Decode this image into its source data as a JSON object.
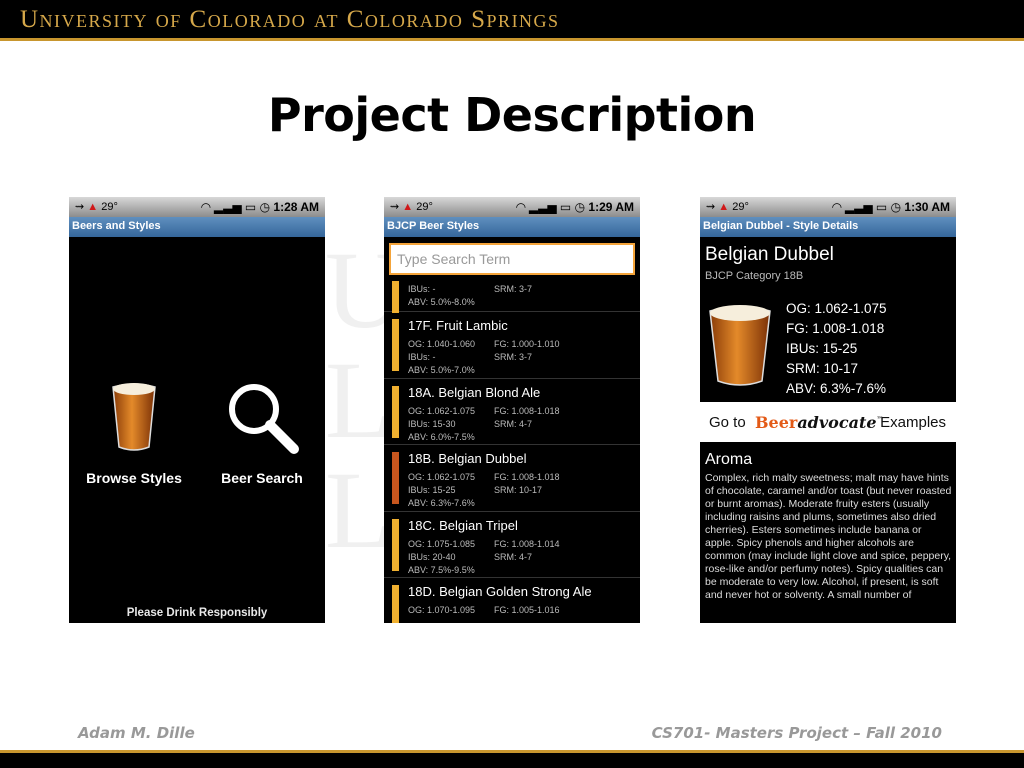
{
  "slide": {
    "banner_title": "University of Colorado at Colorado Springs",
    "title": "Project Description",
    "footer_left": "Adam M. Dille",
    "footer_right": "CS701- Masters Project – Fall 2010"
  },
  "colors": {
    "banner_gold": "#c8962e",
    "titlebar_blue": "#35669a",
    "search_border": "#f4a43a",
    "beeradvocate_orange": "#e35a17"
  },
  "phone1": {
    "status": {
      "temp": "29°",
      "time": "1:28 AM"
    },
    "titlebar": "Beers and Styles",
    "browse_label": "Browse Styles",
    "search_label": "Beer Search",
    "footer": "Please Drink Responsibly"
  },
  "phone2": {
    "status": {
      "temp": "29°",
      "time": "1:29 AM"
    },
    "titlebar": "BJCP Beer Styles",
    "search_placeholder": "Type Search Term",
    "partial": {
      "ibus": "IBUs: -",
      "srm": "SRM: 3-7",
      "abv": "ABV: 5.0%-8.0%",
      "color": "#f0b030"
    },
    "items": [
      {
        "name": "17F. Fruit Lambic",
        "og": "OG: 1.040-1.060",
        "fg": "FG: 1.000-1.010",
        "ibus": "IBUs: -",
        "srm": "SRM: 3-7",
        "abv": "ABV: 5.0%-7.0%",
        "color": "#f0b030"
      },
      {
        "name": "18A. Belgian Blond Ale",
        "og": "OG: 1.062-1.075",
        "fg": "FG: 1.008-1.018",
        "ibus": "IBUs: 15-30",
        "srm": "SRM: 4-7",
        "abv": "ABV: 6.0%-7.5%",
        "color": "#f0b030"
      },
      {
        "name": "18B. Belgian Dubbel",
        "og": "OG: 1.062-1.075",
        "fg": "FG: 1.008-1.018",
        "ibus": "IBUs: 15-25",
        "srm": "SRM: 10-17",
        "abv": "ABV: 6.3%-7.6%",
        "color": "#c8561e"
      },
      {
        "name": "18C. Belgian Tripel",
        "og": "OG: 1.075-1.085",
        "fg": "FG: 1.008-1.014",
        "ibus": "IBUs: 20-40",
        "srm": "SRM: 4-7",
        "abv": "ABV: 7.5%-9.5%",
        "color": "#f0b030"
      },
      {
        "name": "18D. Belgian Golden Strong Ale",
        "og": "OG: 1.070-1.095",
        "fg": "FG: 1.005-1.016",
        "ibus": "",
        "srm": "",
        "abv": "",
        "color": "#f0b030"
      }
    ]
  },
  "phone3": {
    "status": {
      "temp": "29°",
      "time": "1:30 AM"
    },
    "titlebar": "Belgian Dubbel - Style Details",
    "name": "Belgian Dubbel",
    "category": "BJCP Category 18B",
    "og": "OG: 1.062-1.075",
    "fg": "FG: 1.008-1.018",
    "ibus": "IBUs: 15-25",
    "srm": "SRM: 10-17",
    "abv": "ABV: 6.3%-7.6%",
    "goto": "Go to",
    "logo_beer": "Beer",
    "logo_advocate": "advocate",
    "logo_tm": "™",
    "examples": "Examples",
    "aroma_heading": "Aroma",
    "aroma_text": "Complex, rich malty sweetness; malt may have hints of chocolate, caramel and/or toast (but never roasted or burnt aromas).  Moderate fruity esters (usually including raisins and plums, sometimes also dried cherries).  Esters sometimes include banana or apple.  Spicy phenols and higher alcohols are common (may include light clove and spice, peppery, rose-like and/or perfumy notes).  Spicy qualities can be moderate to very low.  Alcohol, if present, is soft and never hot or solventy.  A small number of"
  }
}
